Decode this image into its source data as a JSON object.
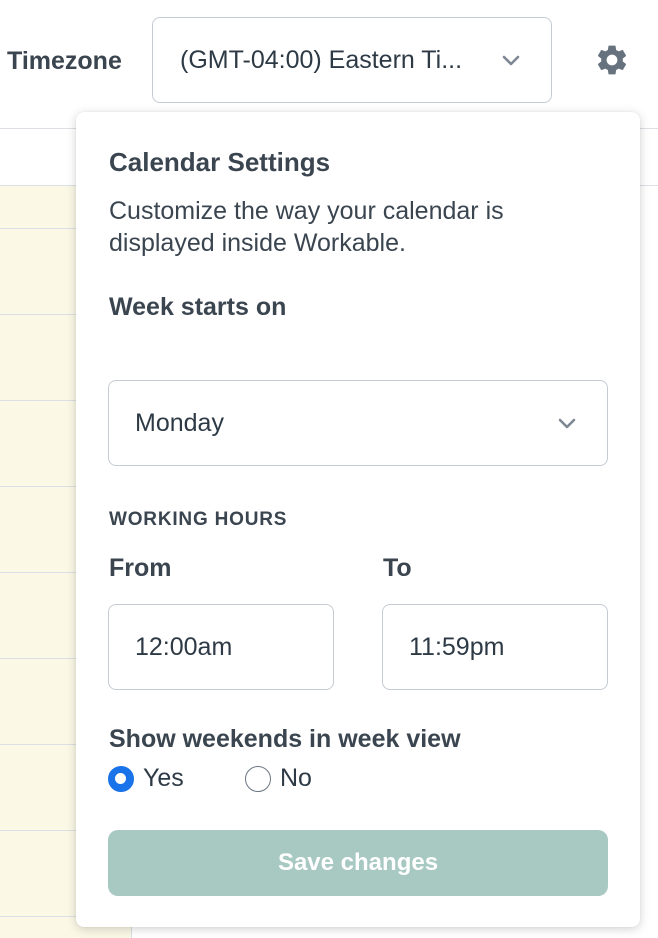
{
  "header": {
    "timezone_label": "Timezone",
    "timezone_value": "(GMT-04:00) Eastern Ti...",
    "icons": {
      "timezone_dropdown": "chevron-down-icon",
      "settings": "gear-icon"
    }
  },
  "settings": {
    "title": "Calendar Settings",
    "description": "Customize the way your calendar is displayed inside Workable.",
    "week_starts_label": "Week starts on",
    "week_starts_value": "Monday",
    "working_hours_heading": "WORKING HOURS",
    "from_label": "From",
    "from_value": "12:00am",
    "to_label": "To",
    "to_value": "11:59pm",
    "weekends_label": "Show weekends in week view",
    "yes_label": "Yes",
    "no_label": "No",
    "weekends_selected": "Yes",
    "save_label": "Save changes"
  },
  "colors": {
    "accent": "#1a73e8",
    "save_button": "#a8c8c2",
    "calendar_highlight": "#fbf8e6",
    "icon": "#66727e"
  }
}
